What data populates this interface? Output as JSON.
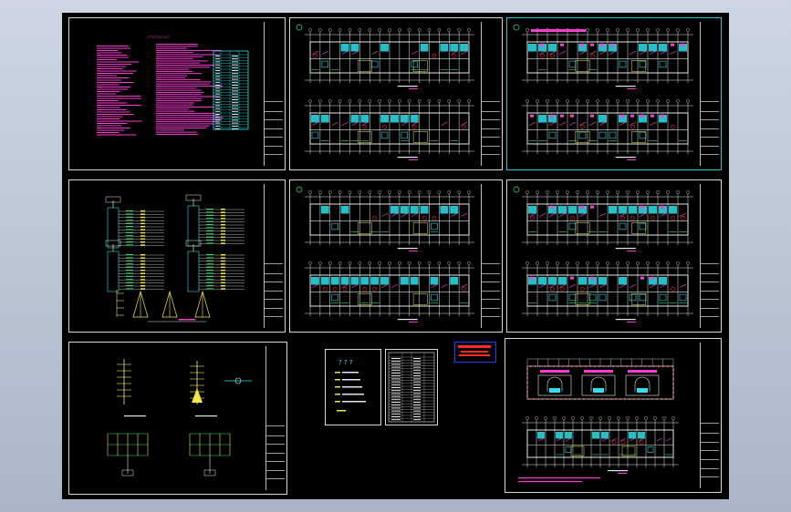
{
  "viewer": {
    "background_colors": [
      "#cdd6e2",
      "#aab6c7"
    ],
    "canvas_color": "#000000"
  },
  "colors": {
    "cad_magenta": "#ff3bd6",
    "cad_cyan": "#2de0ea",
    "cad_yellow": "#f2e84a",
    "cad_red": "#ff2a2a",
    "cad_white": "#e6e6e6",
    "cad_green": "#35e06a",
    "selection_border": "#25c9d6",
    "stamp_border": "#1e3cff"
  },
  "sheets": [
    {
      "id": "s1",
      "kind": "design-notes",
      "icon": "notes-sheet"
    },
    {
      "id": "s2",
      "kind": "floor-plan",
      "icon": "floor-plan-sheet"
    },
    {
      "id": "s3",
      "kind": "floor-plan",
      "icon": "floor-plan-sheet",
      "selected": true
    },
    {
      "id": "s4",
      "kind": "riser-diagram",
      "icon": "system-diagram-sheet"
    },
    {
      "id": "s5",
      "kind": "floor-plan",
      "icon": "floor-plan-sheet"
    },
    {
      "id": "s6",
      "kind": "floor-plan",
      "icon": "floor-plan-sheet"
    },
    {
      "id": "s7",
      "kind": "detail-diagram",
      "icon": "system-diagram-sheet"
    },
    {
      "id": "s8",
      "kind": "cover-and-index",
      "icon": "index-sheet"
    },
    {
      "id": "s9",
      "kind": "roof-and-ground-plan",
      "icon": "floor-plan-sheet"
    }
  ],
  "cover": {
    "question_marks": "? ? ?"
  }
}
